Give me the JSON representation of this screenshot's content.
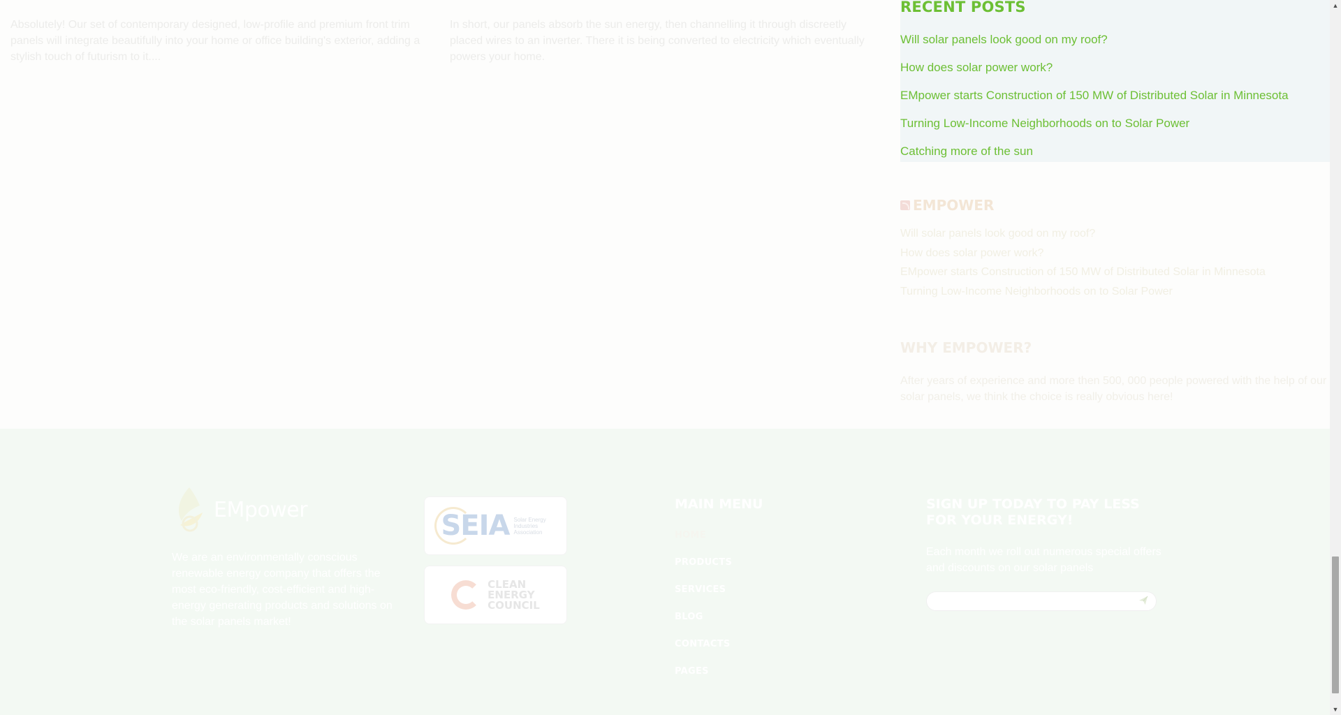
{
  "excerpts": [
    {
      "text": "Absolutely! Our set of contemporary designed, low-profile and premium front trim panels will integrate beautifully into your home or office building's exterior, adding a stylish touch of futurism to it...."
    },
    {
      "text": "In short, our panels absorb the sun energy, then channelling it through discreetly placed wires to an inverter. There it is being converted to electricity which eventually powers your home."
    }
  ],
  "sidebar": {
    "recent_posts": {
      "title": "RECENT POSTS",
      "items": [
        "Will solar panels look good on my roof?",
        "How does solar power work?",
        "EMpower starts Construction of 150 MW of Distributed Solar in Minnesota",
        "Turning Low-Income Neighborhoods on to Solar Power",
        "Catching more of the sun"
      ]
    },
    "rss": {
      "title": "EMPOWER",
      "items": [
        "Will solar panels look good on my roof?",
        "How does solar power work?",
        "EMpower starts Construction of 150 MW of Distributed Solar in Minnesota",
        "Turning Low-Income Neighborhoods on to Solar Power"
      ]
    },
    "why": {
      "title": "WHY EMPOWER?",
      "text": "After years of experience and more then 500, 000 people powered with the help of our solar panels, we think the choice is really obvious here!"
    }
  },
  "footer": {
    "logo_text": "EMpower",
    "about": "We are an environmentally conscious renewable energy company that offers the most eco-friendly, cost-efficient and high-energy generating products and solutions on the solar panels market!",
    "partners": {
      "seia": {
        "mark": "SEIA",
        "sub": "Solar Energy Industries Association"
      },
      "cec": {
        "line1": "CLEAN",
        "line2": "ENERGY",
        "line3": "COUNCIL"
      }
    },
    "main_menu": {
      "title": "MAIN MENU",
      "items": [
        "HOME",
        "PRODUCTS",
        "SERVICES",
        "BLOG",
        "CONTACTS",
        "PAGES"
      ]
    },
    "signup": {
      "title": "SIGN UP TODAY TO PAY LESS FOR YOUR ENERGY!",
      "text": "Each month we roll out numerous special offers and discounts on our solar panels",
      "email_value": "",
      "placeholder": ""
    }
  },
  "colors": {
    "accent_green": "#6cbf34",
    "footer_bg": "#f3f9f3",
    "sidebar_highlight": "#f1f6f7"
  },
  "icons": {
    "rss": "rss-icon",
    "send": "paper-plane-icon",
    "scroll_up": "scroll-up-arrow-icon",
    "scroll_down": "scroll-down-arrow-icon"
  }
}
